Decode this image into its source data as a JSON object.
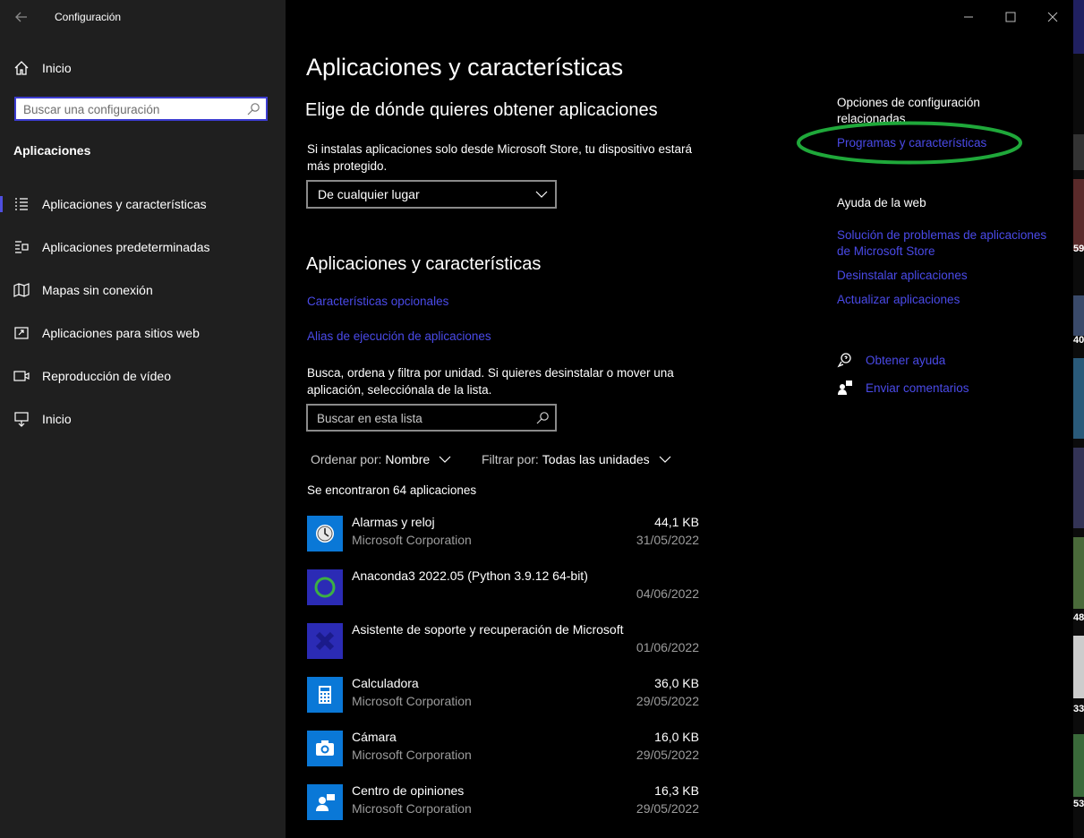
{
  "window": {
    "title": "Configuración",
    "minimize": "—",
    "maximize": "☐",
    "close": "✕"
  },
  "sidebar": {
    "home_label": "Inicio",
    "search_placeholder": "Buscar una configuración",
    "section_title": "Aplicaciones",
    "items": [
      {
        "label": "Aplicaciones y características",
        "icon": "list-icon",
        "active": true
      },
      {
        "label": "Aplicaciones predeterminadas",
        "icon": "default-apps-icon",
        "active": false
      },
      {
        "label": "Mapas sin conexión",
        "icon": "map-icon",
        "active": false
      },
      {
        "label": "Aplicaciones para sitios web",
        "icon": "web-apps-icon",
        "active": false
      },
      {
        "label": "Reproducción de vídeo",
        "icon": "video-icon",
        "active": false
      },
      {
        "label": "Inicio",
        "icon": "startup-icon",
        "active": false
      }
    ]
  },
  "main": {
    "title": "Aplicaciones y características",
    "source_heading": "Elige de dónde quieres obtener aplicaciones",
    "source_desc": "Si instalas aplicaciones solo desde Microsoft Store, tu dispositivo estará más protegido.",
    "source_value": "De cualquier lugar",
    "apps_heading": "Aplicaciones y características",
    "optional_features_link": "Características opcionales",
    "alias_link": "Alias de ejecución de aplicaciones",
    "search_desc": "Busca, ordena y filtra por unidad. Si quieres desinstalar o mover una aplicación, selecciónala de la lista.",
    "list_search_placeholder": "Buscar en esta lista",
    "sort_prefix": "Ordenar por:",
    "sort_value": "Nombre",
    "filter_prefix": "Filtrar por:",
    "filter_value": "Todas las unidades",
    "count_text": "Se encontraron 64 aplicaciones",
    "apps": [
      {
        "name": "Alarmas y reloj",
        "publisher": "Microsoft Corporation",
        "size": "44,1 KB",
        "date": "31/05/2022",
        "icon": "alarm-clock-icon",
        "color": "#0a78d7"
      },
      {
        "name": "Anaconda3 2022.05 (Python 3.9.12 64-bit)",
        "publisher": "",
        "size": "",
        "date": "04/06/2022",
        "icon": "anaconda-icon",
        "color": "#2b2bb5"
      },
      {
        "name": "Asistente de soporte y recuperación de Microsoft",
        "publisher": "",
        "size": "",
        "date": "01/06/2022",
        "icon": "support-assistant-icon",
        "color": "#2b2bb5"
      },
      {
        "name": "Calculadora",
        "publisher": "Microsoft Corporation",
        "size": "36,0 KB",
        "date": "29/05/2022",
        "icon": "calculator-icon",
        "color": "#0a78d7"
      },
      {
        "name": "Cámara",
        "publisher": "Microsoft Corporation",
        "size": "16,0 KB",
        "date": "29/05/2022",
        "icon": "camera-icon",
        "color": "#0a78d7"
      },
      {
        "name": "Centro de opiniones",
        "publisher": "Microsoft Corporation",
        "size": "16,3 KB",
        "date": "29/05/2022",
        "icon": "feedback-hub-icon",
        "color": "#0a78d7"
      }
    ]
  },
  "related": {
    "heading": "Opciones de configuración relacionadas",
    "programs_link": "Programas y características",
    "web_help_heading": "Ayuda de la web",
    "links": [
      "Solución de problemas de aplicaciones de Microsoft Store",
      "Desinstalar aplicaciones",
      "Actualizar aplicaciones"
    ],
    "get_help": "Obtener ayuda",
    "send_feedback": "Enviar comentarios"
  },
  "annotation": {
    "color": "#1fa83a"
  },
  "background_edge": {
    "labels": [
      "59",
      "40",
      "48",
      "33",
      "53"
    ]
  },
  "colors": {
    "accent_link": "#4a4ae8",
    "sidebar_bg": "#1f1f1f",
    "main_bg": "#000000"
  }
}
